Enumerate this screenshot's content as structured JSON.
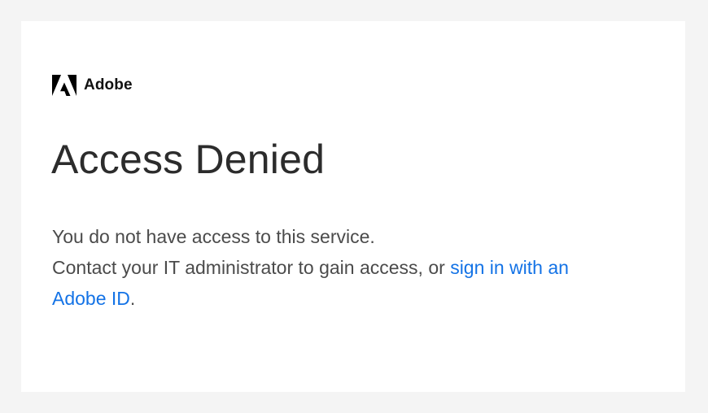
{
  "brand": {
    "icon": "adobe-logo-icon",
    "name": "Adobe",
    "color": "#000000"
  },
  "page": {
    "title": "Access Denied",
    "message_line1": "You do not have access to this service.",
    "message_line2_prefix": "Contact your IT administrator to gain access, or ",
    "link_text": "sign in with an Adobe ID",
    "message_line2_suffix": "."
  },
  "colors": {
    "background": "#f4f4f4",
    "card": "#ffffff",
    "link": "#1473e6",
    "title": "#2c2c2c",
    "body_text": "#4b4b4b"
  }
}
